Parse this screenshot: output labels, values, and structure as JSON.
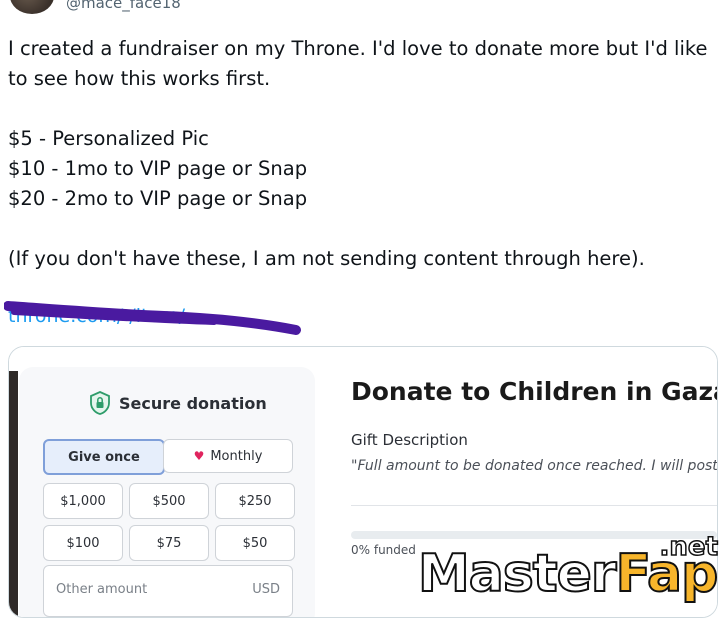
{
  "profile": {
    "handle": "@mace_face18"
  },
  "tweet": {
    "paragraphs": [
      "I created a fundraiser on my Throne. I'd love to donate more but I'd like to see how this works first.",
      "",
      "$5 - Personalized Pic",
      "$10 - 1mo to VIP page or Snap",
      "$20 - 2mo to VIP page or Snap",
      "",
      "(If you don't have these, I am not sending content through here)."
    ],
    "link": "throne.com/ /item/..."
  },
  "card": {
    "secure_label": "Secure donation",
    "give_once": "Give once",
    "monthly": "Monthly",
    "amounts": [
      "$1,000",
      "$500",
      "$250",
      "$100",
      "$75",
      "$50"
    ],
    "other_placeholder": "Other amount",
    "currency": "USD",
    "title": "Donate to Children in Gaza",
    "gift_label": "Gift Description",
    "gift_desc": "\"Full amount to be donated once reached. I will post p",
    "funded_text": "0% funded",
    "funded_fraction": 0
  },
  "watermark": {
    "main": "Master",
    "accent": "Fap",
    "suffix": ".net"
  },
  "colors": {
    "link": "#1d9bf0",
    "scribble": "#4a1aa0",
    "heart": "#e0245e",
    "shield": "#2e9c6a"
  }
}
